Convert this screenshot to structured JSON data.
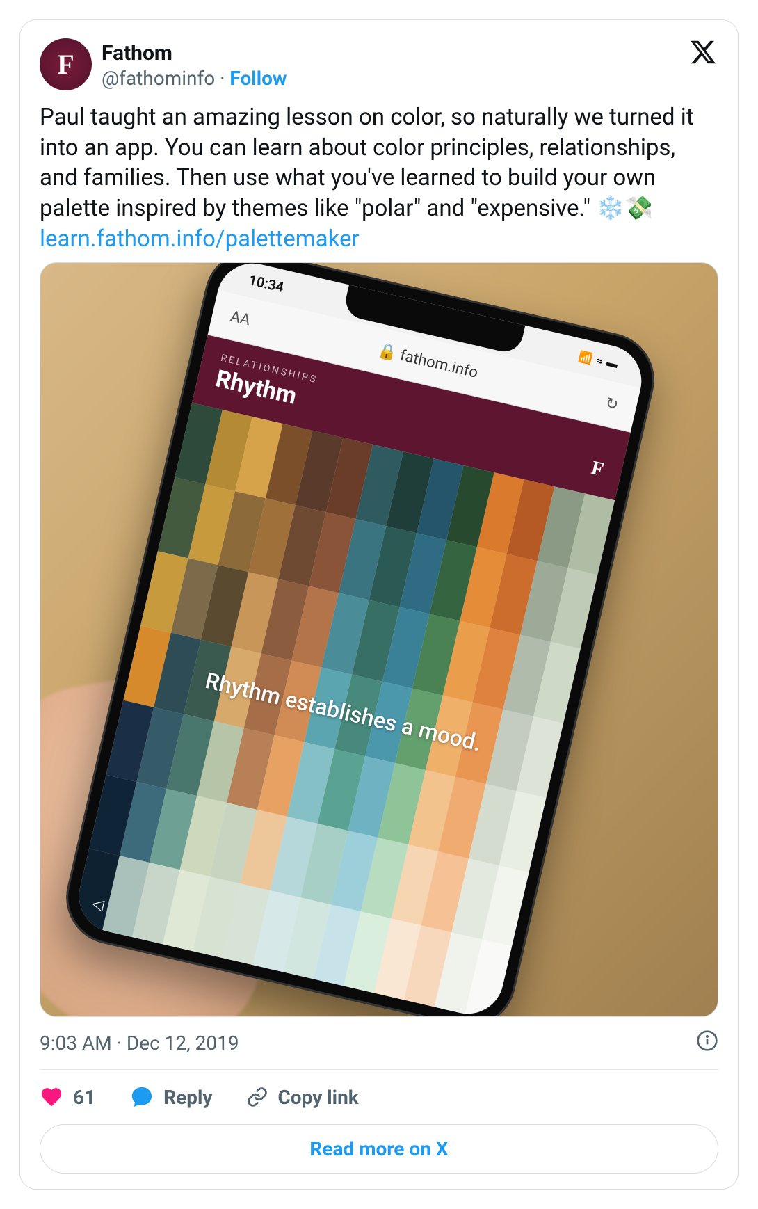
{
  "author": {
    "display_name": "Fathom",
    "handle": "@fathominfo",
    "follow_label": "Follow",
    "avatar_letter": "F"
  },
  "tweet": {
    "text": "Paul taught an amazing lesson on color, so naturally we turned it into an app. You can learn about color principles, relationships, and families. Then use what you've learned to build your own palette inspired by themes like \"polar\" and \"expensive.\" ❄️💸",
    "link_text": "learn.fathom.info/palettemaker"
  },
  "phone": {
    "status_time": "10:34",
    "browser_label_left": "AA",
    "browser_url": "🔒 fathom.info",
    "browser_refresh": "↻",
    "app_eyebrow": "RELATIONSHIPS",
    "app_title": "Rhythm",
    "app_badge": "F",
    "overlay_text": "Rhythm establishes a mood.",
    "nav_arrow": "◁"
  },
  "meta": {
    "timestamp": "9:03 AM · Dec 12, 2019"
  },
  "actions": {
    "like_count": "61",
    "reply_label": "Reply",
    "copy_label": "Copy link"
  },
  "readmore": "Read more on X",
  "separator": " · ",
  "palette_colors": [
    [
      "#2e4a3a",
      "#445a3f",
      "#c79a3e",
      "#d78a2b",
      "#1a2f45",
      "#0f2436",
      "#0e2130"
    ],
    [
      "#b58a34",
      "#c79a3e",
      "#7d6a4a",
      "#2d4c55",
      "#355a68",
      "#3e6b7c",
      "#a9c0bb"
    ],
    [
      "#d6a24a",
      "#8c6a3a",
      "#5a4a2f",
      "#3a5a50",
      "#49776d",
      "#6fa094",
      "#c7d6c8"
    ],
    [
      "#7a4f2a",
      "#a0703a",
      "#c9965a",
      "#d7a96b",
      "#b6c5a7",
      "#cdd8bd",
      "#dfe8d5"
    ],
    [
      "#5a3a2a",
      "#6f4a32",
      "#8b5c3d",
      "#a56e49",
      "#b88056",
      "#c7d4c0",
      "#d8e2d3"
    ],
    [
      "#6a3d2b",
      "#8a5439",
      "#b37449",
      "#d18b54",
      "#e7a263",
      "#edc79a",
      "#d7e3d6"
    ],
    [
      "#2e5a60",
      "#3a7480",
      "#4a8d99",
      "#5aa5b0",
      "#86c0c7",
      "#b6d8da",
      "#d6e8e8"
    ],
    [
      "#1f3e3a",
      "#2a5a53",
      "#386f65",
      "#47897b",
      "#5aa292",
      "#a8cfc6",
      "#d2e6e0"
    ],
    [
      "#25556a",
      "#2f6b82",
      "#3a8198",
      "#4b98ad",
      "#6fb3c3",
      "#9ccfd9",
      "#c7e3e9"
    ],
    [
      "#274a2e",
      "#356540",
      "#4a8254",
      "#63a06d",
      "#8fc398",
      "#b7dcc0",
      "#d9eedd"
    ],
    [
      "#d97a2d",
      "#e58c38",
      "#ea9e4c",
      "#efb06a",
      "#f3c38d",
      "#f6d6b2",
      "#f9e6d3"
    ],
    [
      "#b55a24",
      "#cc6d2d",
      "#de823d",
      "#e99652",
      "#f0ab70",
      "#f5c195",
      "#f8d8bd"
    ],
    [
      "#8a9a85",
      "#9daa98",
      "#b0bbac",
      "#c3ccbf",
      "#d4dccf",
      "#e3e9df",
      "#eff3ec"
    ],
    [
      "#aebda4",
      "#bfcbb6",
      "#cfd9c8",
      "#dde4d7",
      "#e9eee3",
      "#f2f5ee",
      "#f9faf7"
    ]
  ]
}
